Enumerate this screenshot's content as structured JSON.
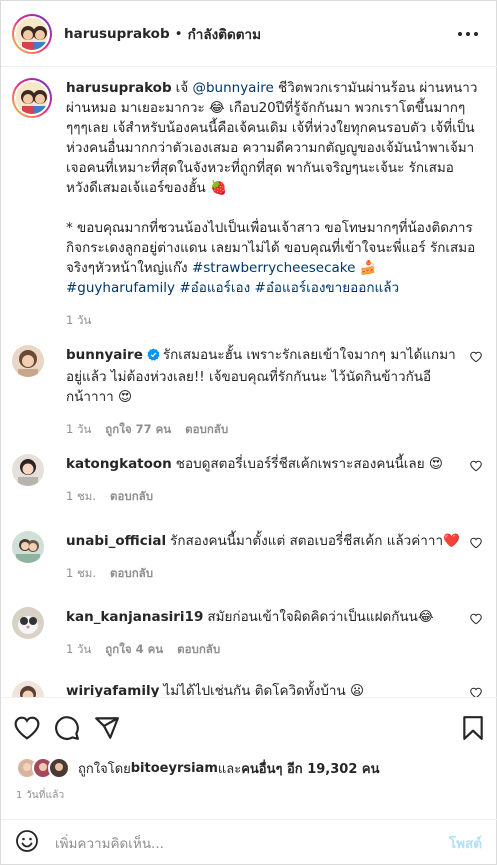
{
  "header": {
    "username": "harusuprakob",
    "separator": "•",
    "follow_status": "กำลังติดตาม"
  },
  "caption": {
    "username": "harusuprakob",
    "text_before_mention": "เจ้ ",
    "mention": "@bunnyaire",
    "text_after_mention": " ชีวิตพวกเรามันผ่านร้อน ผ่านหนาว ผ่านหมอ มาเยอะมากวะ 😂 เกือบ20ปีที่รู้จักกันมา พวกเราโตขึ้นมากๆ ๆๆๆเลย เจ้สำหรับน้องคนนี้คือเจ้คนเดิม เจ้ที่ห่วงใยทุกคนรอบตัว เจ้ที่เป็นห่วงคนอื่นมากกว่าตัวเองเสมอ ความดีความกตัญญูของเจ้มันนำพาเจ้มาเจอคนที่เหมาะที่สุดในจังหวะที่ถูกที่สุด พากันเจริญๆนะเจ้นะ รักเสมอ หวังดีเสมอเจ้แอร์ของฮั้น 🍓",
    "paragraph2": "* ขอบคุณมากที่ชวนน้องไปเป็นเพื่อนเจ้าสาว ขอโทษมากๆที่น้องติดภารกิจกระเดงลูกอยู่ต่างแดน เลยมาไม่ได้ ขอบคุณที่เข้าใจนะพี่แอร์ รักเสมอจริงๆหัวหน้าใหญ่แก๊ง ",
    "tags_inline": "#strawberrycheesecake 🍰",
    "tags_line": "#guyharufamily #อ๋อแอร์เอง #อ๋อแอร์เองขายออกแล้ว",
    "time": "1 วัน"
  },
  "comments": [
    {
      "username": "bunnyaire",
      "verified": true,
      "text": "รักเสมอนะฮั้น เพราะรักเลยเข้าใจมากๆ มาได้แกมาอยู่แล้ว ไม่ต้องห่วงเลย!! เจ้ขอบคุณที่รักกันนะ ไว้นัดกินข้าวกันอีกน้าาาา 😍",
      "time": "1 วัน",
      "likes": "ถูกใจ 77 คน",
      "reply": "ตอบกลับ"
    },
    {
      "username": "katongkatoon",
      "verified": false,
      "text": "ชอบดูสตอรี่เบอร์รี่ชีสเค้กเพราะสองคนนี้เลย 😍",
      "time": "1 ชม.",
      "likes": "",
      "reply": "ตอบกลับ"
    },
    {
      "username": "unabi_official",
      "verified": false,
      "text": "รักสองคนนี้มาตั้งแต่ สตอเบอรี่ชีสเค้ก แล้วค่าาา❤️",
      "time": "1 ชม.",
      "likes": "",
      "reply": "ตอบกลับ"
    },
    {
      "username": "kan_kanjanasiri19",
      "verified": false,
      "text": "สมัยก่อนเข้าใจผิดคิดว่าเป็นแฝดกันน😂",
      "time": "1 วัน",
      "likes": "ถูกใจ 4 คน",
      "reply": "ตอบกลับ"
    },
    {
      "username": "wiriyafamily",
      "verified": false,
      "text": "ไม่ได้ไปเช่นกัน ติดโควิดทั้งบ้าน 😦",
      "time": "",
      "likes": "",
      "reply": ""
    }
  ],
  "likes_row": {
    "prefix": "ถูกใจโดย ",
    "first_user": "bitoeyrsiam",
    "middle": " และ",
    "others": "คนอื่นๆ อีก 19,302 คน"
  },
  "timestamp": "1 วันที่แล้ว",
  "add_comment": {
    "placeholder": "เพิ่มความคิดเห็น...",
    "post_label": "โพสต์"
  },
  "colors": {
    "link": "#00376b",
    "muted": "#8e8e8e",
    "post_disabled": "#b2dffc",
    "verified": "#0095f6"
  },
  "icons": [
    "more-options-icon",
    "heart-icon",
    "comment-icon",
    "share-icon",
    "bookmark-icon",
    "emoji-icon",
    "verified-badge-icon"
  ]
}
